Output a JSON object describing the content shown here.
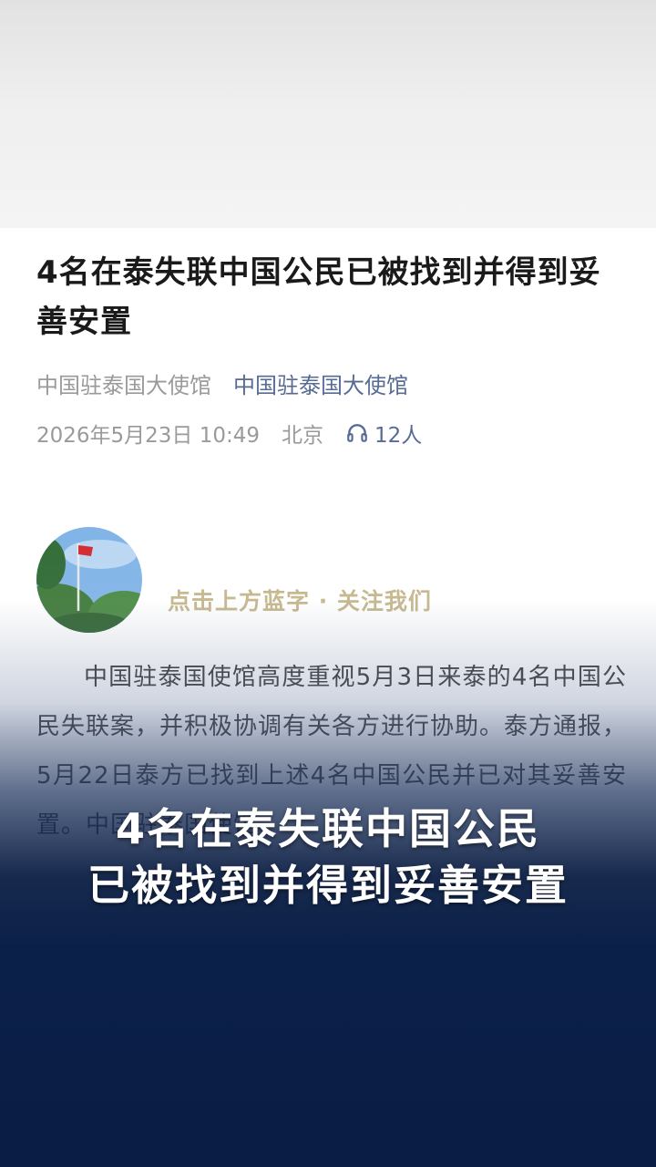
{
  "article": {
    "title": "4名在泰失联中国公民已被找到并得到妥善安置",
    "source_name": "中国驻泰国大使馆",
    "account_link": "中国驻泰国大使馆",
    "date": "2026年5月23日 10:49",
    "location": "北京",
    "listen_count": "12人",
    "follow_tip": "点击上方蓝字 · 关注我们",
    "body": "中国驻泰国使馆高度重视5月3日来泰的4名中国公民失联案，并积极协调有关各方进行协助。泰方通报，5月22日泰方已找到上述4名中国公民并已对其妥善安置。中国驻泰国使馆"
  },
  "caption": {
    "line1": "4名在泰失联中国公民",
    "line2": "已被找到并得到妥善安置"
  },
  "colors": {
    "link": "#576b95",
    "follow_tip": "#c4b58a",
    "caption_bg": "#0b2049"
  },
  "icons": {
    "listen": "headphones-icon",
    "avatar": "flag-avatar"
  }
}
